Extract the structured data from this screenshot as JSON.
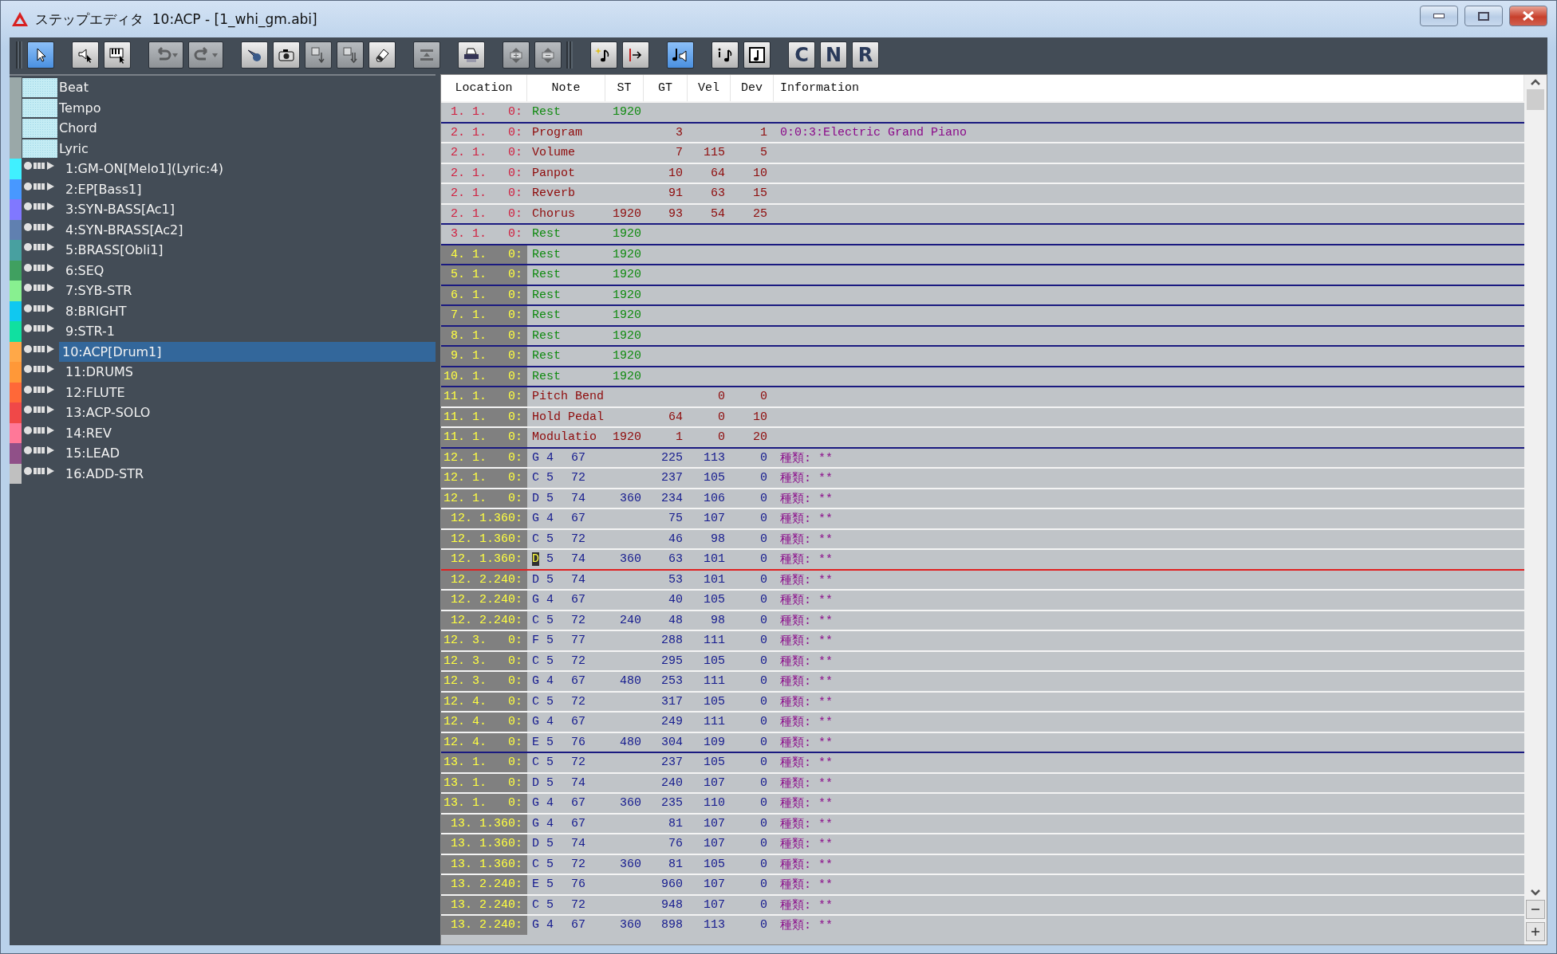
{
  "window": {
    "title": "ステップエディタ  10:ACP - [1_whi_gm.abi]"
  },
  "toolbar": [
    {
      "kind": "icon",
      "selected": true,
      "disabled": false
    },
    {
      "kind": "icon",
      "selected": false,
      "disabled": false
    },
    {
      "kind": "icon",
      "selected": false,
      "disabled": false
    },
    {
      "kind": "icon",
      "selected": false,
      "disabled": true
    },
    {
      "kind": "icon",
      "selected": false,
      "disabled": true
    },
    {
      "kind": "icon",
      "selected": false,
      "disabled": false
    },
    {
      "kind": "icon",
      "selected": false,
      "disabled": false
    },
    {
      "kind": "icon",
      "selected": false,
      "disabled": true
    },
    {
      "kind": "icon",
      "selected": false,
      "disabled": true
    },
    {
      "kind": "icon",
      "selected": false,
      "disabled": false
    },
    {
      "kind": "icon",
      "selected": false,
      "disabled": true
    },
    {
      "kind": "icon",
      "selected": false,
      "disabled": false
    },
    {
      "kind": "icon",
      "selected": false,
      "disabled": true
    },
    {
      "kind": "icon",
      "selected": false,
      "disabled": true
    },
    {
      "kind": "icon",
      "selected": false,
      "disabled": false
    },
    {
      "kind": "icon",
      "selected": false,
      "disabled": false
    },
    {
      "kind": "icon",
      "selected": true,
      "disabled": false
    },
    {
      "kind": "icon",
      "selected": false,
      "disabled": false
    },
    {
      "kind": "icon",
      "selected": false,
      "disabled": false
    },
    {
      "kind": "letter",
      "label": "C",
      "selected": false,
      "disabled": false
    },
    {
      "kind": "letter",
      "label": "N",
      "selected": false,
      "disabled": false
    },
    {
      "kind": "letter",
      "label": "R",
      "selected": false,
      "disabled": false
    }
  ],
  "tracks": [
    {
      "kind": "special",
      "name": "Beat",
      "selected": false
    },
    {
      "kind": "special",
      "name": "Tempo",
      "selected": false
    },
    {
      "kind": "special",
      "name": "Chord",
      "selected": false
    },
    {
      "kind": "special",
      "name": "Lyric",
      "selected": false
    },
    {
      "kind": "track",
      "name": "1:GM-ON[Melo1](Lyric:4)",
      "color": "#40f0ff",
      "selected": false
    },
    {
      "kind": "track",
      "name": "2:EP[Bass1]",
      "color": "#4898ff",
      "selected": false
    },
    {
      "kind": "track",
      "name": "3:SYN-BASS[Ac1]",
      "color": "#8078ff",
      "selected": false
    },
    {
      "kind": "track",
      "name": "4:SYN-BRASS[Ac2]",
      "color": "#6080b0",
      "selected": false
    },
    {
      "kind": "track",
      "name": "5:BRASS[Obli1]",
      "color": "#48a0a0",
      "selected": false
    },
    {
      "kind": "track",
      "name": "6:SEQ",
      "color": "#40a060",
      "selected": false
    },
    {
      "kind": "track",
      "name": "7:SYB-STR",
      "color": "#88f090",
      "selected": false
    },
    {
      "kind": "track",
      "name": "8:BRIGHT",
      "color": "#10c8f0",
      "selected": false
    },
    {
      "kind": "track",
      "name": "9:STR-1",
      "color": "#10e0a0",
      "selected": false
    },
    {
      "kind": "track",
      "name": "10:ACP[Drum1]",
      "color": "#ffa848",
      "selected": true
    },
    {
      "kind": "track",
      "name": "11:DRUMS",
      "color": "#ff9838",
      "selected": false
    },
    {
      "kind": "track",
      "name": "12:FLUTE",
      "color": "#ff6838",
      "selected": false
    },
    {
      "kind": "track",
      "name": "13:ACP-SOLO",
      "color": "#f04848",
      "selected": false
    },
    {
      "kind": "track",
      "name": "14:REV",
      "color": "#ff7898",
      "selected": false
    },
    {
      "kind": "track",
      "name": "15:LEAD",
      "color": "#905088",
      "selected": false
    },
    {
      "kind": "track",
      "name": "16:ADD-STR",
      "color": "#c0c0c0",
      "selected": false
    }
  ],
  "table": {
    "columns": [
      "Location",
      "Note",
      "ST",
      "GT",
      "Vel",
      "Dev",
      "Information"
    ],
    "rows": [
      {
        "kind": "rest",
        "location": "1. 1.   0:",
        "note": "Rest",
        "st": "1920",
        "marked": false,
        "bar_start": false,
        "cursor": false
      },
      {
        "kind": "control",
        "location": "2. 1.   0:",
        "note": "Program",
        "gt": "3",
        "dev": "1",
        "info": "0:0:3:Electric Grand Piano",
        "marked": false,
        "bar_start": true,
        "cursor": false
      },
      {
        "kind": "control",
        "location": "2. 1.   0:",
        "note": "Volume",
        "gt": "7",
        "vel": "115",
        "dev": "5",
        "marked": false,
        "bar_start": false,
        "cursor": false
      },
      {
        "kind": "control",
        "location": "2. 1.   0:",
        "note": "Panpot",
        "gt": "10",
        "vel": "64",
        "dev": "10",
        "marked": false,
        "bar_start": false,
        "cursor": false
      },
      {
        "kind": "control",
        "location": "2. 1.   0:",
        "note": "Reverb",
        "gt": "91",
        "vel": "63",
        "dev": "15",
        "marked": false,
        "bar_start": false,
        "cursor": false
      },
      {
        "kind": "control",
        "location": "2. 1.   0:",
        "note": "Chorus",
        "st": "1920",
        "gt": "93",
        "vel": "54",
        "dev": "25",
        "marked": false,
        "bar_start": false,
        "cursor": false
      },
      {
        "kind": "rest",
        "location": "3. 1.   0:",
        "note": "Rest",
        "st": "1920",
        "marked": false,
        "bar_start": true,
        "cursor": false
      },
      {
        "kind": "rest",
        "location": "4. 1.   0:",
        "note": "Rest",
        "st": "1920",
        "marked": true,
        "bar_start": true,
        "cursor": false
      },
      {
        "kind": "rest",
        "location": "5. 1.   0:",
        "note": "Rest",
        "st": "1920",
        "marked": true,
        "bar_start": true,
        "cursor": false
      },
      {
        "kind": "rest",
        "location": "6. 1.   0:",
        "note": "Rest",
        "st": "1920",
        "marked": true,
        "bar_start": true,
        "cursor": false
      },
      {
        "kind": "rest",
        "location": "7. 1.   0:",
        "note": "Rest",
        "st": "1920",
        "marked": true,
        "bar_start": true,
        "cursor": false
      },
      {
        "kind": "rest",
        "location": "8. 1.   0:",
        "note": "Rest",
        "st": "1920",
        "marked": true,
        "bar_start": true,
        "cursor": false
      },
      {
        "kind": "rest",
        "location": "9. 1.   0:",
        "note": "Rest",
        "st": "1920",
        "marked": true,
        "bar_start": true,
        "cursor": false
      },
      {
        "kind": "rest",
        "location": "10. 1.   0:",
        "note": "Rest",
        "st": "1920",
        "marked": true,
        "bar_start": true,
        "cursor": false
      },
      {
        "kind": "control",
        "location": "11. 1.   0:",
        "note": "Pitch Bend",
        "vel": "0",
        "dev": "0",
        "marked": true,
        "bar_start": true,
        "cursor": false
      },
      {
        "kind": "control",
        "location": "11. 1.   0:",
        "note": "Hold Pedal",
        "gt": "64",
        "vel": "0",
        "dev": "10",
        "marked": true,
        "bar_start": false,
        "cursor": false
      },
      {
        "kind": "control",
        "location": "11. 1.   0:",
        "note": "Modulatio",
        "st": "1920",
        "gt": "1",
        "vel": "0",
        "dev": "20",
        "marked": true,
        "bar_start": false,
        "cursor": false
      },
      {
        "kind": "note",
        "location": "12. 1.   0:",
        "note": "G 4",
        "number": "67",
        "gt": "225",
        "vel": "113",
        "dev": "0",
        "info": "種類: **",
        "marked": true,
        "bar_start": true,
        "cursor": false
      },
      {
        "kind": "note",
        "location": "12. 1.   0:",
        "note": "C 5",
        "number": "72",
        "gt": "237",
        "vel": "105",
        "dev": "0",
        "info": "種類: **",
        "marked": true,
        "bar_start": false,
        "cursor": false
      },
      {
        "kind": "note",
        "location": "12. 1.   0:",
        "note": "D 5",
        "number": "74",
        "st": "360",
        "gt": "234",
        "vel": "106",
        "dev": "0",
        "info": "種類: **",
        "marked": true,
        "bar_start": false,
        "cursor": false
      },
      {
        "kind": "note",
        "location": "12. 1.360:",
        "note": "G 4",
        "number": "67",
        "gt": "75",
        "vel": "107",
        "dev": "0",
        "info": "種類: **",
        "marked": true,
        "bar_start": false,
        "cursor": false
      },
      {
        "kind": "note",
        "location": "12. 1.360:",
        "note": "C 5",
        "number": "72",
        "gt": "46",
        "vel": "98",
        "dev": "0",
        "info": "種類: **",
        "marked": true,
        "bar_start": false,
        "cursor": false
      },
      {
        "kind": "note",
        "location": "12. 1.360:",
        "note": "D 5",
        "number": "74",
        "st": "360",
        "gt": "63",
        "vel": "101",
        "dev": "0",
        "info": "種類: **",
        "marked": true,
        "bar_start": false,
        "cursor": true
      },
      {
        "kind": "note",
        "location": "12. 2.240:",
        "note": "D 5",
        "number": "74",
        "gt": "53",
        "vel": "101",
        "dev": "0",
        "info": "種類: **",
        "marked": true,
        "bar_start": false,
        "cursor": false
      },
      {
        "kind": "note",
        "location": "12. 2.240:",
        "note": "G 4",
        "number": "67",
        "gt": "40",
        "vel": "105",
        "dev": "0",
        "info": "種類: **",
        "marked": true,
        "bar_start": false,
        "cursor": false
      },
      {
        "kind": "note",
        "location": "12. 2.240:",
        "note": "C 5",
        "number": "72",
        "st": "240",
        "gt": "48",
        "vel": "98",
        "dev": "0",
        "info": "種類: **",
        "marked": true,
        "bar_start": false,
        "cursor": false
      },
      {
        "kind": "note",
        "location": "12. 3.   0:",
        "note": "F 5",
        "number": "77",
        "gt": "288",
        "vel": "111",
        "dev": "0",
        "info": "種類: **",
        "marked": true,
        "bar_start": false,
        "cursor": false
      },
      {
        "kind": "note",
        "location": "12. 3.   0:",
        "note": "C 5",
        "number": "72",
        "gt": "295",
        "vel": "105",
        "dev": "0",
        "info": "種類: **",
        "marked": true,
        "bar_start": false,
        "cursor": false
      },
      {
        "kind": "note",
        "location": "12. 3.   0:",
        "note": "G 4",
        "number": "67",
        "st": "480",
        "gt": "253",
        "vel": "111",
        "dev": "0",
        "info": "種類: **",
        "marked": true,
        "bar_start": false,
        "cursor": false
      },
      {
        "kind": "note",
        "location": "12. 4.   0:",
        "note": "C 5",
        "number": "72",
        "gt": "317",
        "vel": "105",
        "dev": "0",
        "info": "種類: **",
        "marked": true,
        "bar_start": false,
        "cursor": false
      },
      {
        "kind": "note",
        "location": "12. 4.   0:",
        "note": "G 4",
        "number": "67",
        "gt": "249",
        "vel": "111",
        "dev": "0",
        "info": "種類: **",
        "marked": true,
        "bar_start": false,
        "cursor": false
      },
      {
        "kind": "note",
        "location": "12. 4.   0:",
        "note": "E 5",
        "number": "76",
        "st": "480",
        "gt": "304",
        "vel": "109",
        "dev": "0",
        "info": "種類: **",
        "marked": true,
        "bar_start": false,
        "cursor": false
      },
      {
        "kind": "note",
        "location": "13. 1.   0:",
        "note": "C 5",
        "number": "72",
        "gt": "237",
        "vel": "105",
        "dev": "0",
        "info": "種類: **",
        "marked": true,
        "bar_start": true,
        "cursor": false
      },
      {
        "kind": "note",
        "location": "13. 1.   0:",
        "note": "D 5",
        "number": "74",
        "gt": "240",
        "vel": "107",
        "dev": "0",
        "info": "種類: **",
        "marked": true,
        "bar_start": false,
        "cursor": false
      },
      {
        "kind": "note",
        "location": "13. 1.   0:",
        "note": "G 4",
        "number": "67",
        "st": "360",
        "gt": "235",
        "vel": "110",
        "dev": "0",
        "info": "種類: **",
        "marked": true,
        "bar_start": false,
        "cursor": false
      },
      {
        "kind": "note",
        "location": "13. 1.360:",
        "note": "G 4",
        "number": "67",
        "gt": "81",
        "vel": "107",
        "dev": "0",
        "info": "種類: **",
        "marked": true,
        "bar_start": false,
        "cursor": false
      },
      {
        "kind": "note",
        "location": "13. 1.360:",
        "note": "D 5",
        "number": "74",
        "gt": "76",
        "vel": "107",
        "dev": "0",
        "info": "種類: **",
        "marked": true,
        "bar_start": false,
        "cursor": false
      },
      {
        "kind": "note",
        "location": "13. 1.360:",
        "note": "C 5",
        "number": "72",
        "st": "360",
        "gt": "81",
        "vel": "105",
        "dev": "0",
        "info": "種類: **",
        "marked": true,
        "bar_start": false,
        "cursor": false
      },
      {
        "kind": "note",
        "location": "13. 2.240:",
        "note": "E 5",
        "number": "76",
        "gt": "960",
        "vel": "107",
        "dev": "0",
        "info": "種類: **",
        "marked": true,
        "bar_start": false,
        "cursor": false
      },
      {
        "kind": "note",
        "location": "13. 2.240:",
        "note": "C 5",
        "number": "72",
        "gt": "948",
        "vel": "107",
        "dev": "0",
        "info": "種類: **",
        "marked": true,
        "bar_start": false,
        "cursor": false
      },
      {
        "kind": "note",
        "location": "13. 2.240:",
        "note": "G 4",
        "number": "67",
        "st": "360",
        "gt": "898",
        "vel": "113",
        "dev": "0",
        "info": "種類: **",
        "marked": true,
        "bar_start": false,
        "cursor": false
      }
    ]
  }
}
